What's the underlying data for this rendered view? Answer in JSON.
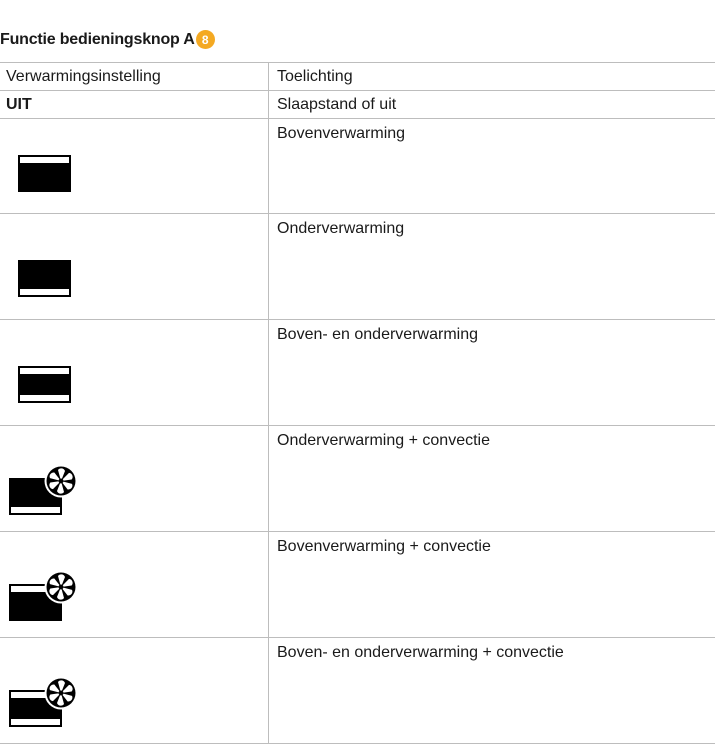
{
  "heading": {
    "text": "Functie bedieningsknop A",
    "badge": "8",
    "badge_color": "#f4a922"
  },
  "table": {
    "col1_header": "Verwarmingsinstelling",
    "col2_header": "Toelichting",
    "rows": [
      {
        "setting": "UIT",
        "explanation": "Slaapstand of uit"
      },
      {
        "icon": "top-heat-icon",
        "explanation": "Bovenverwarming"
      },
      {
        "icon": "bottom-heat-icon",
        "explanation": "Onderverwarming"
      },
      {
        "icon": "top-bottom-heat-icon",
        "explanation": "Boven- en onderverwarming"
      },
      {
        "icon": "bottom-heat-fan-icon",
        "explanation": "Onderverwarming + convectie"
      },
      {
        "icon": "top-heat-fan-icon",
        "explanation": "Bovenverwarming + convectie"
      },
      {
        "icon": "top-bottom-heat-fan-icon",
        "explanation": "Boven- en onderverwarming + convectie"
      }
    ]
  }
}
